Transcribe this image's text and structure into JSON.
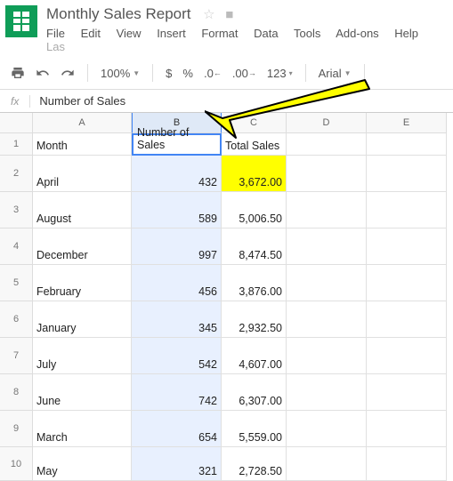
{
  "doc_title": "Monthly Sales Report",
  "menubar": [
    "File",
    "Edit",
    "View",
    "Insert",
    "Format",
    "Data",
    "Tools",
    "Add-ons",
    "Help"
  ],
  "menubar_trail": "Las",
  "toolbar": {
    "zoom": "100%",
    "numfmt": "123",
    "font": "Arial",
    "dollar": "$",
    "percent": "%",
    "dec_less": ".0",
    "dec_more": ".00"
  },
  "formula_label": "fx",
  "formula_value": "Number of Sales",
  "col_headers": [
    "A",
    "B",
    "C",
    "D",
    "E"
  ],
  "row_nums": [
    "1",
    "2",
    "3",
    "4",
    "5",
    "6",
    "7",
    "8",
    "9",
    "10"
  ],
  "headers": {
    "A": "Month",
    "B": "Number of Sales",
    "C": "Total Sales"
  },
  "rows": [
    {
      "A": "April",
      "B": "432",
      "C": "3,672.00"
    },
    {
      "A": "August",
      "B": "589",
      "C": "5,006.50"
    },
    {
      "A": "December",
      "B": "997",
      "C": "8,474.50"
    },
    {
      "A": "February",
      "B": "456",
      "C": "3,876.00"
    },
    {
      "A": "January",
      "B": "345",
      "C": "2,932.50"
    },
    {
      "A": "July",
      "B": "542",
      "C": "4,607.00"
    },
    {
      "A": "June",
      "B": "742",
      "C": "6,307.00"
    },
    {
      "A": "March",
      "B": "654",
      "C": "5,559.00"
    },
    {
      "A": "May",
      "B": "321",
      "C": "2,728.50"
    }
  ]
}
